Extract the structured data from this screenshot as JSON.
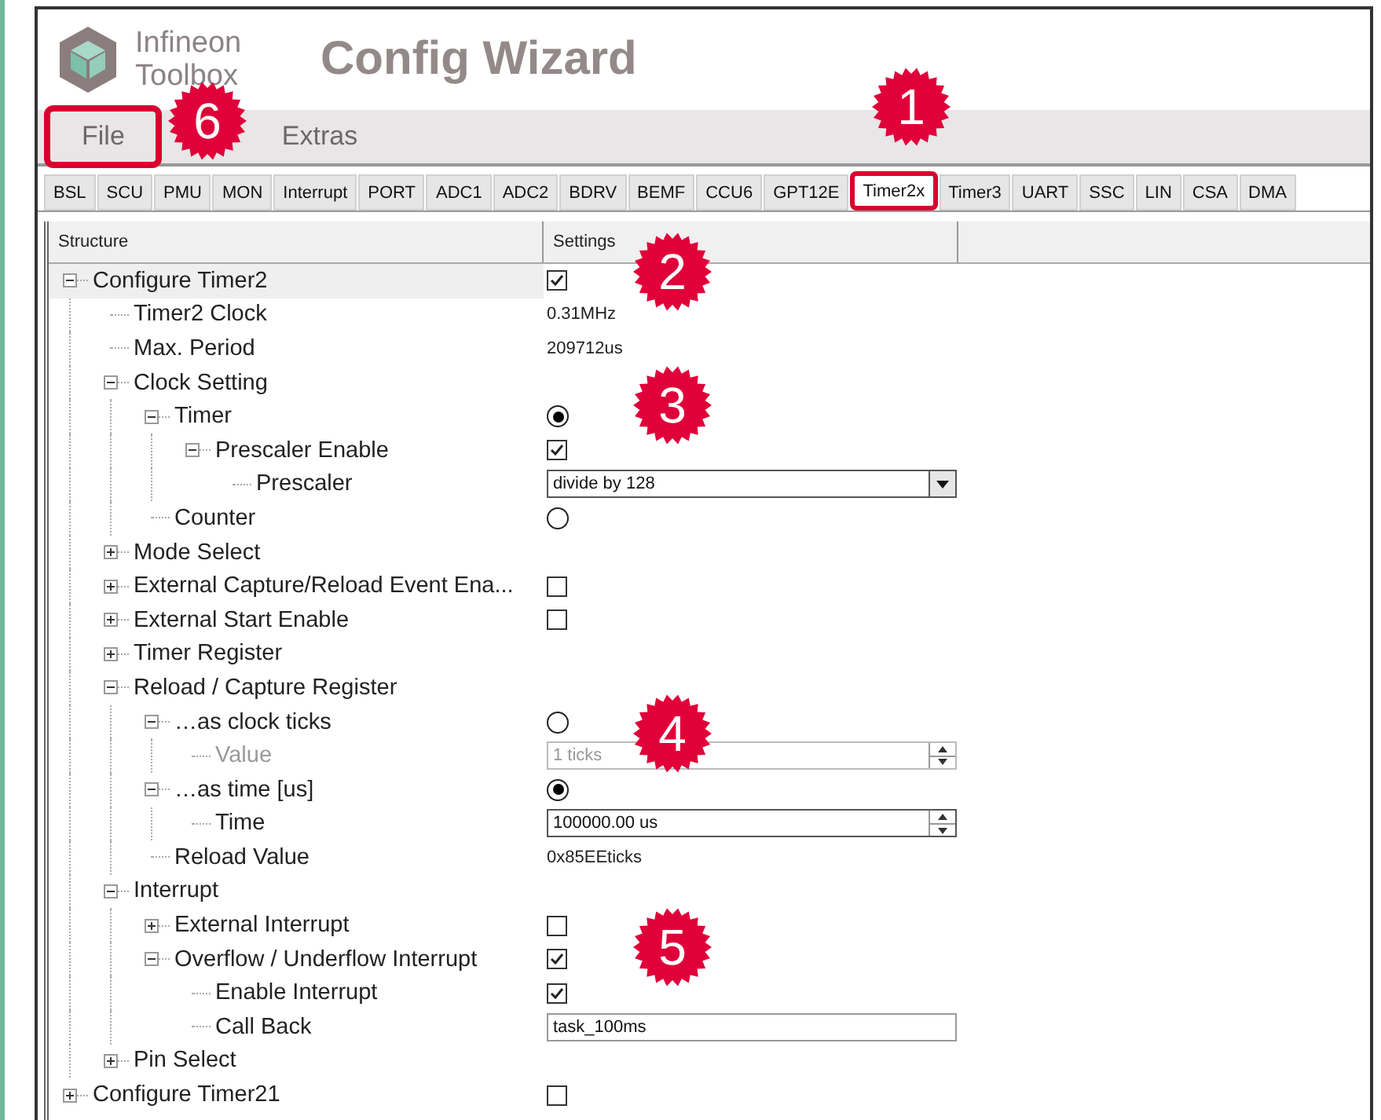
{
  "header": {
    "logo_text": "Infineon Toolbox",
    "title": "Config Wizard"
  },
  "menu": [
    {
      "label": "File",
      "highlighted": true
    },
    {
      "label": "Extras",
      "highlighted": false
    }
  ],
  "tabs": [
    {
      "label": "BSL",
      "selected": false,
      "highlighted": false
    },
    {
      "label": "SCU",
      "selected": false,
      "highlighted": false
    },
    {
      "label": "PMU",
      "selected": false,
      "highlighted": false
    },
    {
      "label": "MON",
      "selected": false,
      "highlighted": false
    },
    {
      "label": "Interrupt",
      "selected": false,
      "highlighted": false
    },
    {
      "label": "PORT",
      "selected": false,
      "highlighted": false
    },
    {
      "label": "ADC1",
      "selected": false,
      "highlighted": false
    },
    {
      "label": "ADC2",
      "selected": false,
      "highlighted": false
    },
    {
      "label": "BDRV",
      "selected": false,
      "highlighted": false
    },
    {
      "label": "BEMF",
      "selected": false,
      "highlighted": false
    },
    {
      "label": "CCU6",
      "selected": false,
      "highlighted": false
    },
    {
      "label": "GPT12E",
      "selected": false,
      "highlighted": false
    },
    {
      "label": "Timer2x",
      "selected": true,
      "highlighted": true
    },
    {
      "label": "Timer3",
      "selected": false,
      "highlighted": false
    },
    {
      "label": "UART",
      "selected": false,
      "highlighted": false
    },
    {
      "label": "SSC",
      "selected": false,
      "highlighted": false
    },
    {
      "label": "LIN",
      "selected": false,
      "highlighted": false
    },
    {
      "label": "CSA",
      "selected": false,
      "highlighted": false
    },
    {
      "label": "DMA",
      "selected": false,
      "highlighted": false
    }
  ],
  "tree": {
    "columns": [
      "Structure",
      "Settings"
    ],
    "nodes": [
      {
        "label": "Configure Timer2",
        "expanded": true,
        "selected": true,
        "setting": {
          "kind": "checkbox",
          "checked": true
        },
        "children": [
          {
            "label": "Timer2 Clock",
            "selected": false,
            "setting": {
              "kind": "text",
              "value": "0.31MHz"
            }
          },
          {
            "label": "Max. Period",
            "selected": false,
            "setting": {
              "kind": "text",
              "value": "209712us"
            }
          },
          {
            "label": "Clock Setting",
            "expanded": true,
            "selected": false,
            "children": [
              {
                "label": "Timer",
                "expanded": true,
                "selected": false,
                "setting": {
                  "kind": "radio",
                  "chosen": true
                },
                "children": [
                  {
                    "label": "Prescaler Enable",
                    "expanded": true,
                    "selected": false,
                    "setting": {
                      "kind": "checkbox",
                      "checked": true
                    },
                    "children": [
                      {
                        "label": "Prescaler",
                        "selected": false,
                        "setting": {
                          "kind": "select",
                          "value": "divide by 128"
                        }
                      }
                    ]
                  }
                ]
              },
              {
                "label": "Counter",
                "selected": false,
                "setting": {
                  "kind": "radio",
                  "chosen": false
                }
              }
            ]
          },
          {
            "label": "Mode Select",
            "expanded": false,
            "selected": false
          },
          {
            "label": "External Capture/Reload Event Ena...",
            "expanded": false,
            "selected": false,
            "setting": {
              "kind": "checkbox",
              "checked": false
            }
          },
          {
            "label": "External Start Enable",
            "expanded": false,
            "selected": false,
            "setting": {
              "kind": "checkbox",
              "checked": false
            }
          },
          {
            "label": "Timer Register",
            "expanded": false,
            "selected": false
          },
          {
            "label": "Reload / Capture Register",
            "expanded": true,
            "selected": false,
            "children": [
              {
                "label": "…as clock ticks",
                "expanded": true,
                "selected": false,
                "setting": {
                  "kind": "radio",
                  "chosen": false
                },
                "children": [
                  {
                    "label": "Value",
                    "selected": false,
                    "disabled": true,
                    "setting": {
                      "kind": "spin",
                      "value": "1 ticks"
                    }
                  }
                ]
              },
              {
                "label": "…as time [us]",
                "expanded": true,
                "selected": false,
                "setting": {
                  "kind": "radio",
                  "chosen": true
                },
                "children": [
                  {
                    "label": "Time",
                    "selected": false,
                    "disabled": false,
                    "setting": {
                      "kind": "spin",
                      "value": "100000.00 us"
                    }
                  }
                ]
              },
              {
                "label": "Reload Value",
                "selected": false,
                "setting": {
                  "kind": "text",
                  "value": "0x85EEticks"
                }
              }
            ]
          },
          {
            "label": "Interrupt",
            "expanded": true,
            "selected": false,
            "children": [
              {
                "label": "External Interrupt",
                "expanded": false,
                "selected": false,
                "setting": {
                  "kind": "checkbox",
                  "checked": false
                }
              },
              {
                "label": "Overflow / Underflow Interrupt",
                "expanded": true,
                "selected": false,
                "setting": {
                  "kind": "checkbox",
                  "checked": true
                },
                "children": [
                  {
                    "label": "Enable Interrupt",
                    "selected": false,
                    "setting": {
                      "kind": "checkbox",
                      "checked": true
                    }
                  },
                  {
                    "label": "Call Back",
                    "selected": false,
                    "setting": {
                      "kind": "input",
                      "value": "task_100ms"
                    }
                  }
                ]
              }
            ]
          },
          {
            "label": "Pin Select",
            "expanded": false,
            "selected": false
          }
        ]
      },
      {
        "label": "Configure Timer21",
        "expanded": false,
        "selected": false,
        "setting": {
          "kind": "checkbox",
          "checked": false
        }
      }
    ]
  },
  "callouts": [
    {
      "number": "1"
    },
    {
      "number": "2"
    },
    {
      "number": "3"
    },
    {
      "number": "4"
    },
    {
      "number": "5"
    },
    {
      "number": "6"
    }
  ]
}
